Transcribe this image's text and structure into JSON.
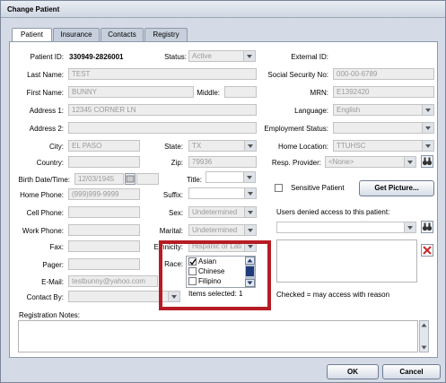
{
  "window": {
    "title": "Change Patient"
  },
  "tabs": [
    {
      "label": "Patient",
      "active": true
    },
    {
      "label": "Insurance",
      "active": false
    },
    {
      "label": "Contacts",
      "active": false
    },
    {
      "label": "Registry",
      "active": false
    }
  ],
  "patient_id": {
    "label": "Patient ID:",
    "value": "330949-2826001"
  },
  "status": {
    "label": "Status:",
    "value": "Active"
  },
  "external_id": {
    "label": "External ID:"
  },
  "last_name": {
    "label": "Last Name:",
    "value": "TEST"
  },
  "ssn": {
    "label": "Social Security No:",
    "value": "000-00-6789"
  },
  "first_name": {
    "label": "First Name:",
    "value": "BUNNY"
  },
  "middle": {
    "label": "Middle:"
  },
  "mrn": {
    "label": "MRN:",
    "value": "E1392420"
  },
  "address1": {
    "label": "Address 1:",
    "value": "12345 CORNER LN"
  },
  "language": {
    "label": "Language:",
    "value": "English"
  },
  "address2": {
    "label": "Address 2:"
  },
  "employment_status": {
    "label": "Employment Status:"
  },
  "city": {
    "label": "City:",
    "value": "EL PASO"
  },
  "state": {
    "label": "State:",
    "value": "TX"
  },
  "home_location": {
    "label": "Home Location:",
    "value": "TTUHSC"
  },
  "country": {
    "label": "Country:"
  },
  "zip": {
    "label": "Zip:",
    "value": "79936"
  },
  "resp_provider": {
    "label": "Resp. Provider:",
    "value": "<None>"
  },
  "birth_date": {
    "label": "Birth Date/Time:",
    "value": "12/03/1945"
  },
  "title_field": {
    "label": "Title:"
  },
  "sensitive": {
    "label": "Sensitive Patient"
  },
  "get_picture": {
    "label": "Get Picture..."
  },
  "home_phone": {
    "label": "Home Phone:",
    "value": "(999)999-9999"
  },
  "suffix": {
    "label": "Suffix:"
  },
  "cell_phone": {
    "label": "Cell Phone:"
  },
  "sex": {
    "label": "Sex:",
    "value": "Undetermined"
  },
  "users_denied": {
    "label": "Users denied access to this patient:"
  },
  "work_phone": {
    "label": "Work Phone:"
  },
  "marital": {
    "label": "Marital:",
    "value": "Undetermined"
  },
  "fax": {
    "label": "Fax:"
  },
  "ethnicity": {
    "label": "Ethnicity:",
    "value": "Hispanic or Lati"
  },
  "pager": {
    "label": "Pager:"
  },
  "race": {
    "label": "Race:",
    "options": [
      {
        "label": "Asian",
        "checked": true
      },
      {
        "label": "Chinese",
        "checked": false
      },
      {
        "label": "Filipino",
        "checked": false
      }
    ],
    "items_selected": "Items selected: 1"
  },
  "email": {
    "label": "E-Mail:",
    "value": "testbunny@yahoo.com"
  },
  "contact_by": {
    "label": "Contact By:"
  },
  "checked_note": "Checked = may access with reason",
  "registration_notes": {
    "label": "Registration Notes:"
  },
  "buttons": {
    "ok": "OK",
    "cancel": "Cancel"
  },
  "colors": {
    "highlight_border": "#b61c24",
    "window_bg": "#d4dbe6"
  }
}
